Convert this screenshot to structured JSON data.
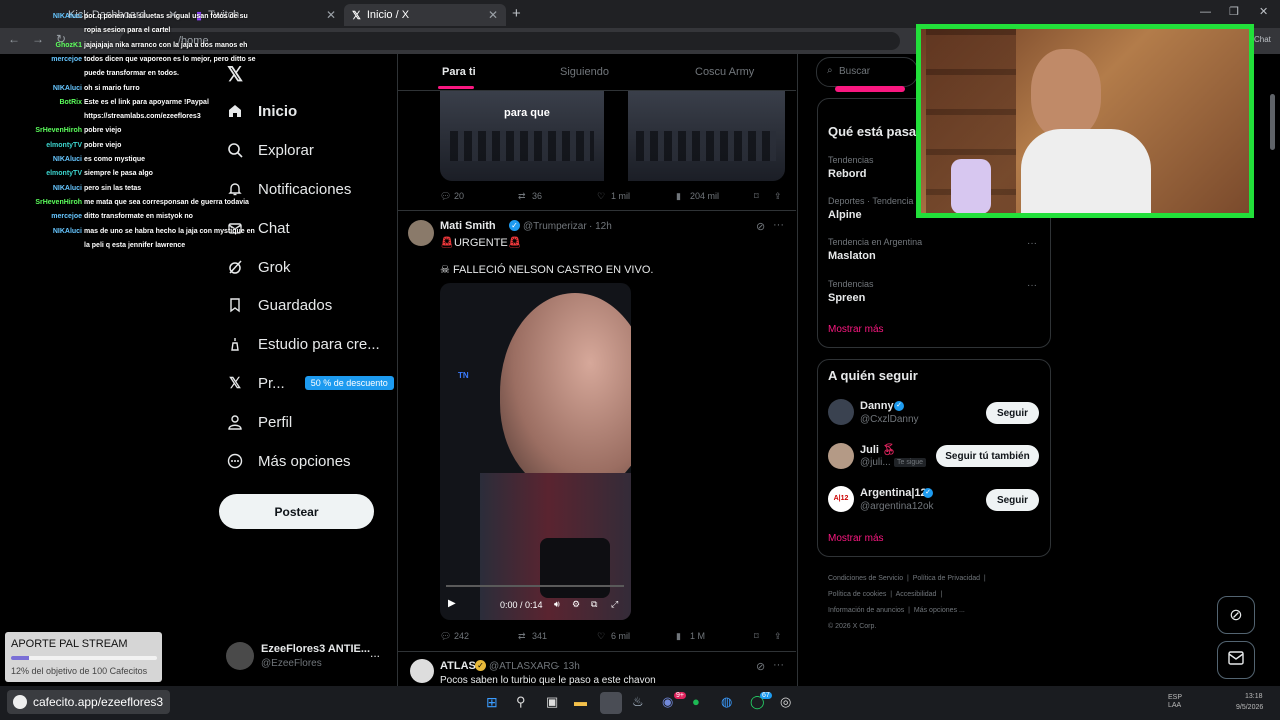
{
  "browser": {
    "tabs": [
      {
        "label": "Kick Dashboard"
      },
      {
        "label": "Twitch"
      },
      {
        "label": "Inicio / X"
      }
    ],
    "address_fragment": "/home",
    "chat_btn": "Chat"
  },
  "nav": {
    "items": [
      {
        "label": "Inicio"
      },
      {
        "label": "Explorar"
      },
      {
        "label": "Notificaciones"
      },
      {
        "label": "Chat"
      },
      {
        "label": "Grok"
      },
      {
        "label": "Guardados"
      },
      {
        "label": "Estudio para cre..."
      },
      {
        "label": "Pr..."
      },
      {
        "label": "Perfil"
      },
      {
        "label": "Más opciones"
      }
    ],
    "premium_badge": "50 % de descuento",
    "post_button": "Postear",
    "account": {
      "name": "EzeeFlores3 ANTIE...",
      "handle": "@EzeeFlores",
      "more": "..."
    }
  },
  "timeline": {
    "tabs": [
      "Para ti",
      "Siguiendo",
      "Coscu Army"
    ],
    "tweet1": {
      "image_caption": "para que",
      "actions": {
        "replies": "20",
        "retweets": "36",
        "likes": "1 mil",
        "views": "204 mil"
      }
    },
    "tweet2": {
      "name": "Mati Smith",
      "handle": "@Trumperizar",
      "time": "· 12h",
      "line1": "URGENTE",
      "line2": "FALLECIÓ NELSON CASTRO EN VIVO.",
      "video_time": "0:00 / 0:14",
      "actions": {
        "replies": "242",
        "retweets": "341",
        "likes": "6 mil",
        "views": "1 M"
      }
    },
    "tweet3": {
      "name": "ATLAS",
      "handle": "@ATLASXARG",
      "time": "· 13h",
      "text": "Pocos saben lo turbio que le paso a este chavon"
    }
  },
  "right": {
    "search_placeholder": "Buscar",
    "trends_title": "Qué está pasa",
    "trends": [
      {
        "category": "Tendencias",
        "name": "Rebord"
      },
      {
        "category": "Deportes · Tendencia",
        "name": "Alpine"
      },
      {
        "category": "Tendencia en Argentina",
        "name": "Maslaton"
      },
      {
        "category": "Tendencias",
        "name": "Spreen"
      }
    ],
    "show_more": "Mostrar más",
    "follow_title": "A quién seguir",
    "follow": [
      {
        "name": "Danny",
        "handle": "@CxzlDanny",
        "button": "Seguir"
      },
      {
        "name": "Juli",
        "handle": "@juli...",
        "tag": "Te sigue",
        "button": "Seguir tú también"
      },
      {
        "name": "Argentina|12",
        "handle": "@argentina12ok",
        "button": "Seguir"
      }
    ],
    "follow_more": "Mostrar más",
    "footer": [
      "Condiciones de Servicio",
      "Política de Privacidad",
      "Política de cookies",
      "Accesibilidad",
      "Información de anuncios",
      "Más opciones ...",
      "© 2026 X Corp."
    ]
  },
  "chat": {
    "lines": [
      {
        "user": "NIKAluci",
        "text": "por q ponen las siluetas si igual usan fotos de su"
      },
      {
        "user": "",
        "text": "ropia sesion para el cartel"
      },
      {
        "user": "GhozK1",
        "text": "jajajajaja nika arranco con la jaja a dos manos eh"
      },
      {
        "user": "mercejoe",
        "text": "todos dicen que vaporeon es lo mejor, pero ditto se"
      },
      {
        "user": "",
        "text": "puede transformar en todos."
      },
      {
        "user": "NIKAluci",
        "text": "oh si mario furro"
      },
      {
        "user": "BotRix",
        "text": "Este es el link para apoyarme !Paypal"
      },
      {
        "user": "",
        "text": "https://streamlabs.com/ezeeflores3"
      },
      {
        "user": "SrHevenHiroh",
        "text": "pobre viejo"
      },
      {
        "user": "elmontyTV",
        "text": "pobre viejo"
      },
      {
        "user": "NIKAluci",
        "text": "es como mystique"
      },
      {
        "user": "elmontyTV",
        "text": "siempre le pasa algo"
      },
      {
        "user": "NIKAluci",
        "text": "pero sin las tetas"
      },
      {
        "user": "SrHevenHiroh",
        "text": "me mata que sea corresponsan de guerra todavia"
      },
      {
        "user": "mercejoe",
        "text": "ditto transformate en mistyok no"
      },
      {
        "user": "NIKAluci",
        "text": "mas de uno se habra hecho la jaja con mystique en"
      },
      {
        "user": "",
        "text": "la peli q esta jennifer lawrence"
      }
    ]
  },
  "overlay": {
    "donation_title": "APORTE PAL STREAM",
    "donation_text": "12% del objetivo de 100 Cafecitos",
    "donation_progress": 0.12,
    "cafecito_url": "cafecito.app/ezeeflores3"
  },
  "taskbar": {
    "lang": "ESP LAA",
    "time": "13:18",
    "date": "9/5/2026",
    "badge1": "9+",
    "badge2": "67"
  },
  "colors": {
    "accent": "#1d9bf0",
    "pink": "#f91880",
    "webcam_border": "#22e03a"
  }
}
